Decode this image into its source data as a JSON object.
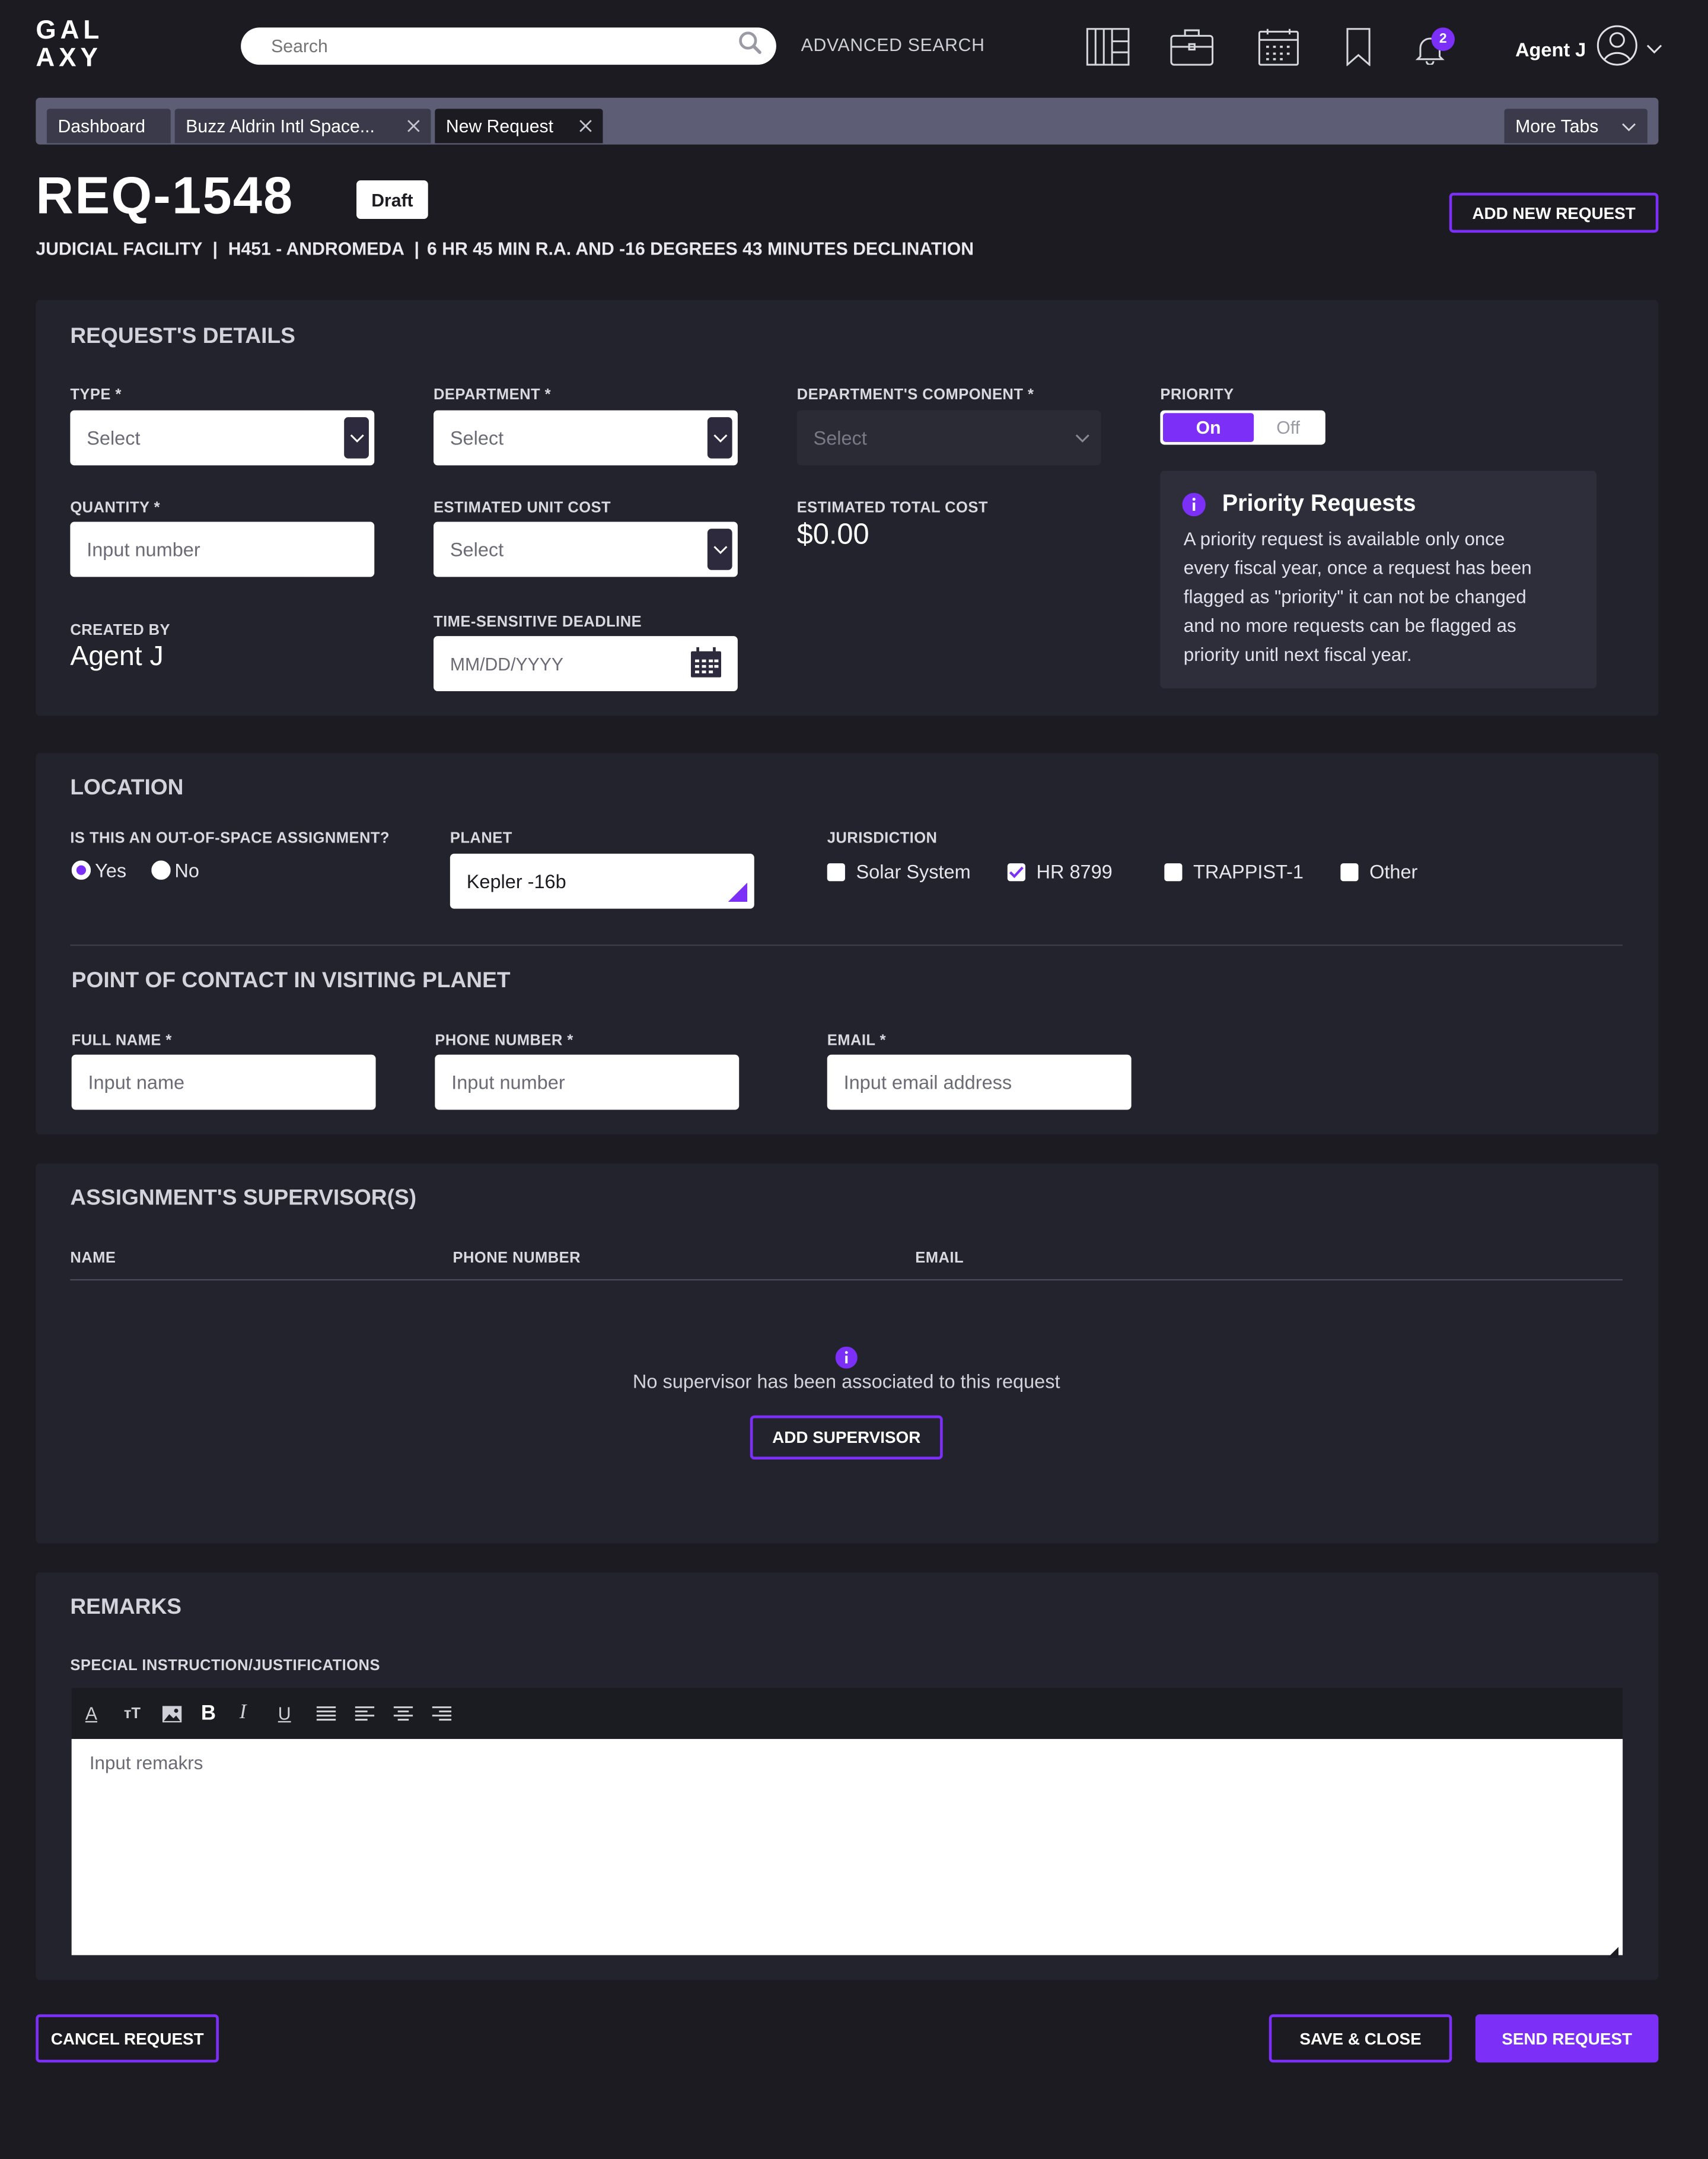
{
  "brand": {
    "line1": "GAL",
    "line2": "AXY"
  },
  "search": {
    "placeholder": "Search",
    "advanced": "ADVANCED SEARCH"
  },
  "nav_icons": [
    "library-icon",
    "briefcase-icon",
    "calendar-icon",
    "bookmark-icon",
    "bell-icon"
  ],
  "notifications": {
    "count": "2"
  },
  "user": {
    "name": "Agent J"
  },
  "tabs": [
    {
      "label": "Dashboard"
    },
    {
      "label": "Buzz Aldrin Intl Space..."
    },
    {
      "label": "New Request"
    }
  ],
  "more_tabs": "More Tabs",
  "request": {
    "id": "REQ-1548",
    "status": "Draft",
    "subtitle": {
      "facility": "JUDICIAL FACILITY",
      "sep1": "|",
      "location": "H451 - ANDROMEDA",
      "sep2": "|",
      "coords": "6 HR 45 MIN R.A. AND -16 DEGREES 43 MINUTES DECLINATION"
    },
    "add_new_label": "ADD NEW REQUEST"
  },
  "details": {
    "title": "REQUEST'S DETAILS",
    "type": {
      "label": "TYPE *",
      "value": "Select"
    },
    "department": {
      "label": "DEPARTMENT *",
      "value": "Select"
    },
    "component": {
      "label": "DEPARTMENT'S COMPONENT *",
      "value": "Select"
    },
    "priority": {
      "label": "PRIORITY",
      "on": "On",
      "off": "Off",
      "selected": "On"
    },
    "quantity": {
      "label": "QUANTITY *",
      "placeholder": "Input number"
    },
    "unit_cost": {
      "label": "ESTIMATED UNIT COST",
      "value": "Select"
    },
    "total_cost": {
      "label": "ESTIMATED TOTAL COST",
      "value": "$0.00"
    },
    "created_by": {
      "label": "CREATED BY",
      "value": "Agent J"
    },
    "deadline": {
      "label": "TIME-SENSITIVE DEADLINE",
      "placeholder": "MM/DD/YYYY"
    },
    "priority_info": {
      "title": "Priority Requests",
      "lines": [
        "A priority request is available only once",
        "every fiscal year, once a request has been",
        "flagged as \"priority\" it can not be changed",
        "and no more requests can be flagged as",
        "priority unitl next fiscal year."
      ]
    }
  },
  "location": {
    "title": "LOCATION",
    "out_of_space": {
      "label": "IS THIS AN OUT-OF-SPACE ASSIGNMENT?",
      "yes": "Yes",
      "no": "No",
      "selected": "Yes"
    },
    "planet": {
      "label": "PLANET",
      "value": "Kepler -16b"
    },
    "jurisdiction": {
      "label": "JURISDICTION",
      "options": [
        {
          "label": "Solar System",
          "checked": false
        },
        {
          "label": "HR 8799",
          "checked": true
        },
        {
          "label": "TRAPPIST-1",
          "checked": false
        },
        {
          "label": "Other",
          "checked": false
        }
      ]
    }
  },
  "contact": {
    "title": "POINT OF CONTACT IN VISITING PLANET",
    "full_name": {
      "label": "FULL NAME *",
      "placeholder": "Input name"
    },
    "phone": {
      "label": "PHONE NUMBER *",
      "placeholder": "Input number"
    },
    "email": {
      "label": "EMAIL *",
      "placeholder": "Input email address"
    }
  },
  "supervisors": {
    "title": "ASSIGNMENT'S SUPERVISOR(S)",
    "columns": [
      "NAME",
      "PHONE NUMBER",
      "EMAIL"
    ],
    "empty_text": "No supervisor has been associated to this request",
    "add_label": "ADD SUPERVISOR"
  },
  "remarks": {
    "title": "REMARKS",
    "field_label": "SPECIAL INSTRUCTION/JUSTIFICATIONS",
    "toolbar": [
      "font-color-icon",
      "text-size-icon",
      "image-icon",
      "bold-icon",
      "italic-icon",
      "underline-icon",
      "justify-icon",
      "align-left-icon",
      "align-center-icon",
      "align-right-icon"
    ],
    "placeholder": "Input remakrs"
  },
  "footer": {
    "cancel": "CANCEL REQUEST",
    "save": "SAVE & CLOSE",
    "send": "SEND REQUEST"
  },
  "colors": {
    "accent": "#7b2ff7",
    "background": "#1b1b21",
    "panel": "#23232d"
  }
}
